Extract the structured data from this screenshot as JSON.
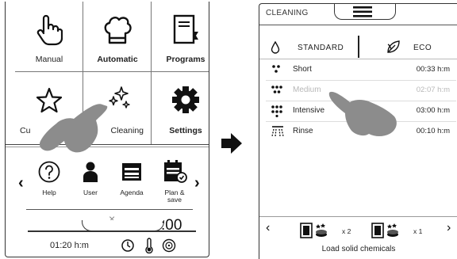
{
  "left": {
    "tiles": {
      "manual": "Manual",
      "automatic": "Automatic",
      "programs": "Programs",
      "custom": "Cu",
      "cleaning": "Cleaning",
      "settings": "Settings"
    },
    "shortcuts": {
      "help": "Help",
      "user": "User",
      "agenda": "Agenda",
      "plan_line1": "Plan &",
      "plan_line2": "save"
    },
    "nav": {
      "prev": "‹",
      "next": "›"
    },
    "close": "×",
    "time_big": ":00",
    "time": "01:20 h:m"
  },
  "right": {
    "title": "CLEANING",
    "tabs": {
      "standard": "STANDARD",
      "eco": "ECO"
    },
    "programs": [
      {
        "name": "Short",
        "time": "00:33 h:m"
      },
      {
        "name": "Medium",
        "time": "02:07 h:m"
      },
      {
        "name": "Intensive",
        "time": "03:00 h:m"
      },
      {
        "name": "Rinse",
        "time": "00:10 h:m"
      }
    ],
    "chemicals": [
      {
        "count": "x 2"
      },
      {
        "count": "x 1"
      }
    ],
    "nav": {
      "prev": "‹",
      "next": "›"
    },
    "footer": "Load solid chemicals"
  },
  "colors": {
    "hand": "#8c8c8c",
    "dim_text": "#b8b8b8",
    "line": "#333333"
  }
}
